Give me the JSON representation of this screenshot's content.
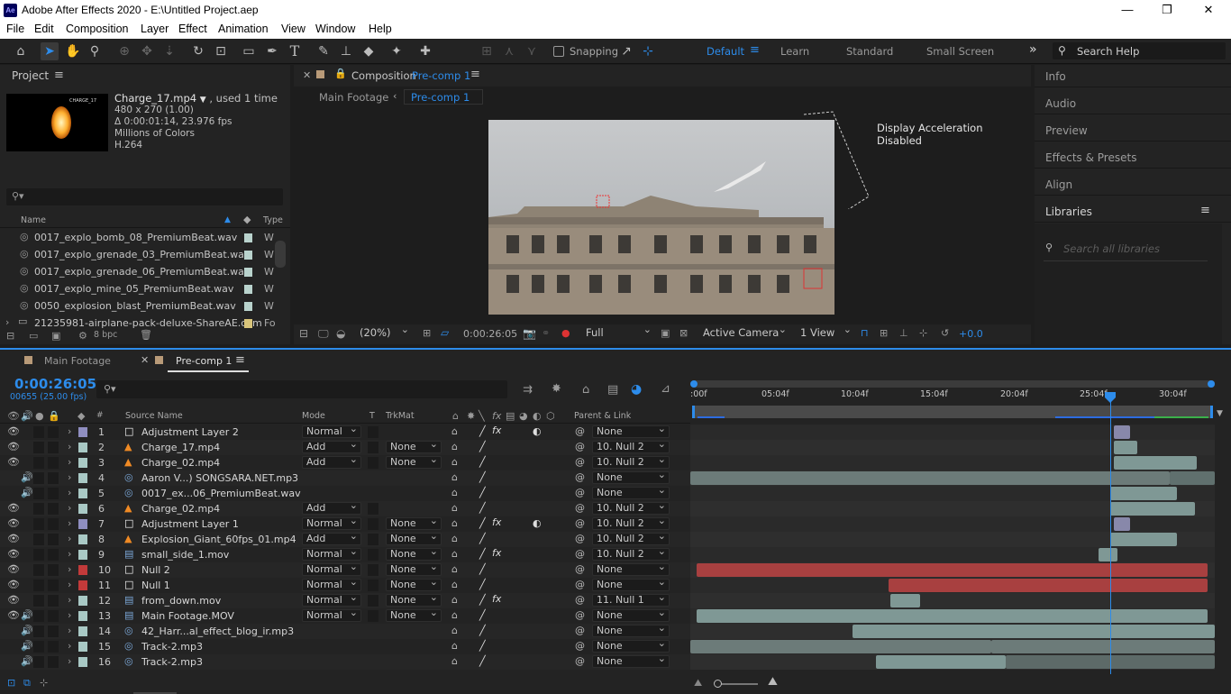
{
  "window": {
    "title": "Adobe After Effects 2020 - E:\\Untitled Project.aep",
    "app_icon": "Ae",
    "minimize": "—",
    "maximize": "❐",
    "close": "✕"
  },
  "menu": [
    "File",
    "Edit",
    "Composition",
    "Layer",
    "Effect",
    "Animation",
    "View",
    "Window",
    "Help"
  ],
  "toolbar": {
    "snapping": "Snapping",
    "workspaces": [
      "Default",
      "Learn",
      "Standard",
      "Small Screen"
    ],
    "active_workspace": "Default",
    "more": "»",
    "search_help_placeholder": "Search Help"
  },
  "project": {
    "tab": "Project",
    "thumb_text": "CHARGE_17",
    "file_name": "Charge_17.mp4",
    "used": ", used 1 time",
    "dims": "480 x 270 (1.00)",
    "duration": "Δ 0:00:01:14, 23.976 fps",
    "colors": "Millions of Colors",
    "codec": "H.264",
    "columns": {
      "name": "Name",
      "type": "Type"
    },
    "files": [
      {
        "name": "0017_explo_bomb_08_PremiumBeat.wav",
        "type": "W"
      },
      {
        "name": "0017_explo_grenade_03_PremiumBeat.wav",
        "type": "W"
      },
      {
        "name": "0017_explo_grenade_06_PremiumBeat.wav",
        "type": "W"
      },
      {
        "name": "0017_explo_mine_05_PremiumBeat.wav",
        "type": "W"
      },
      {
        "name": "0050_explosion_blast_PremiumBeat.wav",
        "type": "W"
      },
      {
        "name": "21235981-airplane-pack-deluxe-ShareAE.com",
        "type": "Fo"
      }
    ],
    "bpc": "8 bpc"
  },
  "composition": {
    "tab_prefix": "Composition",
    "tab_name": "Pre-comp 1",
    "breadcrumbs": [
      "Main Footage",
      "Pre-comp 1"
    ],
    "notice": "Display Acceleration Disabled",
    "zoom": "(20%)",
    "timecode": "0:00:26:05",
    "resolution": "Full",
    "camera": "Active Camera",
    "views": "1 View",
    "exposure": "+0.0"
  },
  "right_panels": {
    "items": [
      "Info",
      "Audio",
      "Preview",
      "Effects & Presets",
      "Align"
    ],
    "libraries": "Libraries",
    "lib_search_placeholder": "Search all libraries"
  },
  "timeline": {
    "tabs": [
      "Main Footage",
      "Pre-comp 1"
    ],
    "active_tab": "Pre-comp 1",
    "timecode": "0:00:26:05",
    "frames": "00655 (25.00 fps)",
    "col_headers": {
      "num": "#",
      "source": "Source Name",
      "mode": "Mode",
      "t": "T",
      "trkmat": "TrkMat",
      "parent": "Parent & Link"
    },
    "ruler": [
      ":00f",
      "05:04f",
      "10:04f",
      "15:04f",
      "20:04f",
      "25:04f",
      "30:04f"
    ],
    "layers": [
      {
        "num": "1",
        "color": "#8f8ec0",
        "icon": "adj",
        "name": "Adjustment Layer 2",
        "mode": "Normal",
        "trkmat": "",
        "fx": "fx",
        "parent": "None",
        "vis": true,
        "aud": false
      },
      {
        "num": "2",
        "color": "#a9c9c5",
        "icon": "vid",
        "name": "Charge_17.mp4",
        "mode": "Add",
        "trkmat": "None",
        "fx": "",
        "parent": "10. Null 2",
        "vis": true,
        "aud": false
      },
      {
        "num": "3",
        "color": "#a9c9c5",
        "icon": "vid",
        "name": "Charge_02.mp4",
        "mode": "Add",
        "trkmat": "None",
        "fx": "",
        "parent": "10. Null 2",
        "vis": true,
        "aud": false
      },
      {
        "num": "4",
        "color": "#a9c9c5",
        "icon": "aud",
        "name": "Aaron V...) SONGSARA.NET.mp3",
        "mode": "",
        "trkmat": "",
        "fx": "",
        "parent": "None",
        "vis": false,
        "aud": true
      },
      {
        "num": "5",
        "color": "#a9c9c5",
        "icon": "aud",
        "name": "0017_ex...06_PremiumBeat.wav",
        "mode": "",
        "trkmat": "",
        "fx": "",
        "parent": "None",
        "vis": false,
        "aud": true
      },
      {
        "num": "6",
        "color": "#a9c9c5",
        "icon": "vid",
        "name": "Charge_02.mp4",
        "mode": "Add",
        "trkmat": "",
        "fx": "",
        "parent": "10. Null 2",
        "vis": true,
        "aud": false
      },
      {
        "num": "7",
        "color": "#8f8ec0",
        "icon": "adj",
        "name": "Adjustment Layer 1",
        "mode": "Normal",
        "trkmat": "None",
        "fx": "fx",
        "parent": "10. Null 2",
        "vis": true,
        "aud": false
      },
      {
        "num": "8",
        "color": "#a9c9c5",
        "icon": "vid",
        "name": "Explosion_Giant_60fps_01.mp4",
        "mode": "Add",
        "trkmat": "None",
        "fx": "",
        "parent": "10. Null 2",
        "vis": true,
        "aud": false
      },
      {
        "num": "9",
        "color": "#a9c9c5",
        "icon": "mov",
        "name": "small_side_1.mov",
        "mode": "Normal",
        "trkmat": "None",
        "fx": "fx",
        "parent": "10. Null 2",
        "vis": true,
        "aud": false
      },
      {
        "num": "10",
        "color": "#c23a3a",
        "icon": "null",
        "name": "Null 2",
        "mode": "Normal",
        "trkmat": "None",
        "fx": "",
        "parent": "None",
        "vis": true,
        "aud": false
      },
      {
        "num": "11",
        "color": "#c23a3a",
        "icon": "null",
        "name": "Null 1",
        "mode": "Normal",
        "trkmat": "None",
        "fx": "",
        "parent": "None",
        "vis": true,
        "aud": false
      },
      {
        "num": "12",
        "color": "#a9c9c5",
        "icon": "mov",
        "name": "from_down.mov",
        "mode": "Normal",
        "trkmat": "None",
        "fx": "fx",
        "parent": "11. Null 1",
        "vis": true,
        "aud": false
      },
      {
        "num": "13",
        "color": "#a9c9c5",
        "icon": "mov",
        "name": "Main Footage.MOV",
        "mode": "Normal",
        "trkmat": "None",
        "fx": "",
        "parent": "None",
        "vis": true,
        "aud": true
      },
      {
        "num": "14",
        "color": "#a9c9c5",
        "icon": "aud",
        "name": "42_Harr...al_effect_blog_ir.mp3",
        "mode": "",
        "trkmat": "",
        "fx": "",
        "parent": "None",
        "vis": false,
        "aud": true
      },
      {
        "num": "15",
        "color": "#a9c9c5",
        "icon": "aud",
        "name": "Track-2.mp3",
        "mode": "",
        "trkmat": "",
        "fx": "",
        "parent": "None",
        "vis": false,
        "aud": true
      },
      {
        "num": "16",
        "color": "#a9c9c5",
        "icon": "aud",
        "name": "Track-2.mp3",
        "mode": "",
        "trkmat": "",
        "fx": "",
        "parent": "None",
        "vis": false,
        "aud": true
      }
    ],
    "colors": {
      "accent": "#2d8ceb",
      "null": "#a84040",
      "clip": "#7a8c8a",
      "adj": "#8888aa"
    }
  }
}
